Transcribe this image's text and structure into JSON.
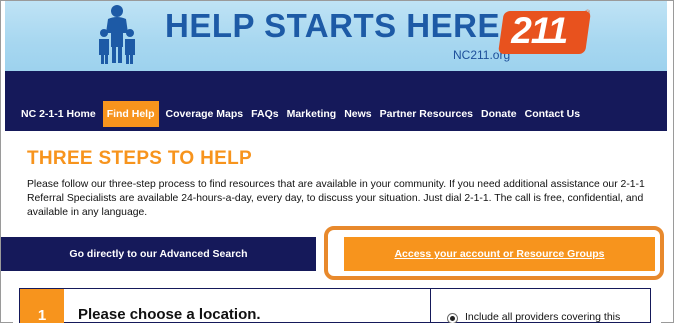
{
  "header": {
    "title": "HELP STARTS HERE.",
    "badge": "211",
    "url": "NC211.org",
    "trademark": "®"
  },
  "nav": {
    "items": [
      {
        "label": "NC 2-1-1 Home"
      },
      {
        "label": "Find Help",
        "active": true
      },
      {
        "label": "Coverage Maps"
      },
      {
        "label": "FAQs"
      },
      {
        "label": "Marketing"
      },
      {
        "label": "News"
      },
      {
        "label": "Partner Resources"
      },
      {
        "label": "Donate"
      },
      {
        "label": "Contact Us"
      }
    ]
  },
  "main": {
    "heading": "THREE STEPS TO HELP",
    "intro": "Please follow our three-step process to find resources that are available in your community. If you need additional assistance our 2-1-1 Referral Specialists are available 24-hours-a-day, every day, to discuss your situation. Just dial 2-1-1. The call is free, confidential, and available in any language.",
    "advanced_search_label": "Go directly to our Advanced Search",
    "account_label": "Access your account or Resource Groups"
  },
  "step": {
    "number": "1",
    "title": "Please choose a location.",
    "option_label": "Include all providers covering this"
  },
  "colors": {
    "navy": "#15195a",
    "orange": "#f7941d",
    "highlight": "#e8892c"
  }
}
